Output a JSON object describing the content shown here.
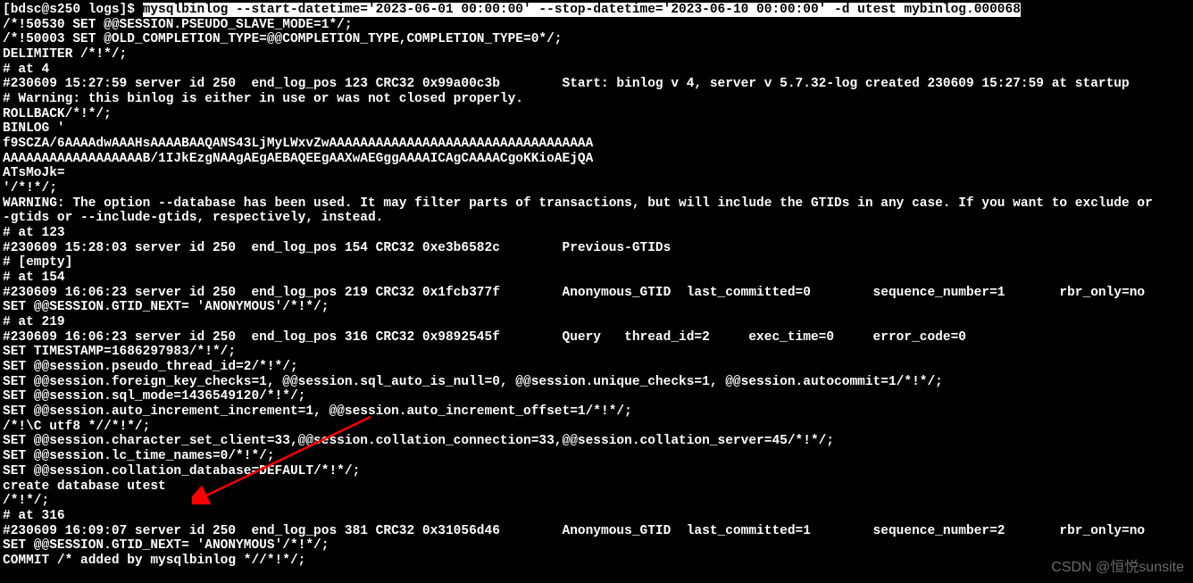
{
  "prompt": "[bdsc@s250 logs]$ ",
  "command": "mysqlbinlog --start-datetime='2023-06-01 00:00:00' --stop-datetime='2023-06-10 00:00:00' -d utest mybinlog.000068",
  "lines": [
    "/*!50530 SET @@SESSION.PSEUDO_SLAVE_MODE=1*/;",
    "/*!50003 SET @OLD_COMPLETION_TYPE=@@COMPLETION_TYPE,COMPLETION_TYPE=0*/;",
    "DELIMITER /*!*/;",
    "# at 4",
    "#230609 15:27:59 server id 250  end_log_pos 123 CRC32 0x99a00c3b        Start: binlog v 4, server v 5.7.32-log created 230609 15:27:59 at startup",
    "# Warning: this binlog is either in use or was not closed properly.",
    "ROLLBACK/*!*/;",
    "BINLOG '",
    "f9SCZA/6AAAAdwAAAHsAAAABAAQANS43LjMyLWxvZwAAAAAAAAAAAAAAAAAAAAAAAAAAAAAAAAAA",
    "AAAAAAAAAAAAAAAAAAB/1IJkEzgNAAgAEgAEBAQEEgAAXwAEGggAAAAICAgCAAAACgoKKioAEjQA",
    "ATsMoJk=",
    "'/*!*/;",
    "WARNING: The option --database has been used. It may filter parts of transactions, but will include the GTIDs in any case. If you want to exclude or",
    "-gtids or --include-gtids, respectively, instead.",
    "# at 123",
    "#230609 15:28:03 server id 250  end_log_pos 154 CRC32 0xe3b6582c        Previous-GTIDs",
    "# [empty]",
    "# at 154",
    "#230609 16:06:23 server id 250  end_log_pos 219 CRC32 0x1fcb377f        Anonymous_GTID  last_committed=0        sequence_number=1       rbr_only=no",
    "SET @@SESSION.GTID_NEXT= 'ANONYMOUS'/*!*/;",
    "# at 219",
    "#230609 16:06:23 server id 250  end_log_pos 316 CRC32 0x9892545f        Query   thread_id=2     exec_time=0     error_code=0",
    "SET TIMESTAMP=1686297983/*!*/;",
    "SET @@session.pseudo_thread_id=2/*!*/;",
    "SET @@session.foreign_key_checks=1, @@session.sql_auto_is_null=0, @@session.unique_checks=1, @@session.autocommit=1/*!*/;",
    "SET @@session.sql_mode=1436549120/*!*/;",
    "SET @@session.auto_increment_increment=1, @@session.auto_increment_offset=1/*!*/;",
    "/*!\\C utf8 *//*!*/;",
    "SET @@session.character_set_client=33,@@session.collation_connection=33,@@session.collation_server=45/*!*/;",
    "SET @@session.lc_time_names=0/*!*/;",
    "SET @@session.collation_database=DEFAULT/*!*/;",
    "create database utest",
    "/*!*/;",
    "# at 316",
    "#230609 16:09:07 server id 250  end_log_pos 381 CRC32 0x31056d46        Anonymous_GTID  last_committed=1        sequence_number=2       rbr_only=no",
    "SET @@SESSION.GTID_NEXT= 'ANONYMOUS'/*!*/;",
    "COMMIT /* added by mysqlbinlog *//*!*/;"
  ],
  "watermark": "CSDN @恒悦sunsite"
}
